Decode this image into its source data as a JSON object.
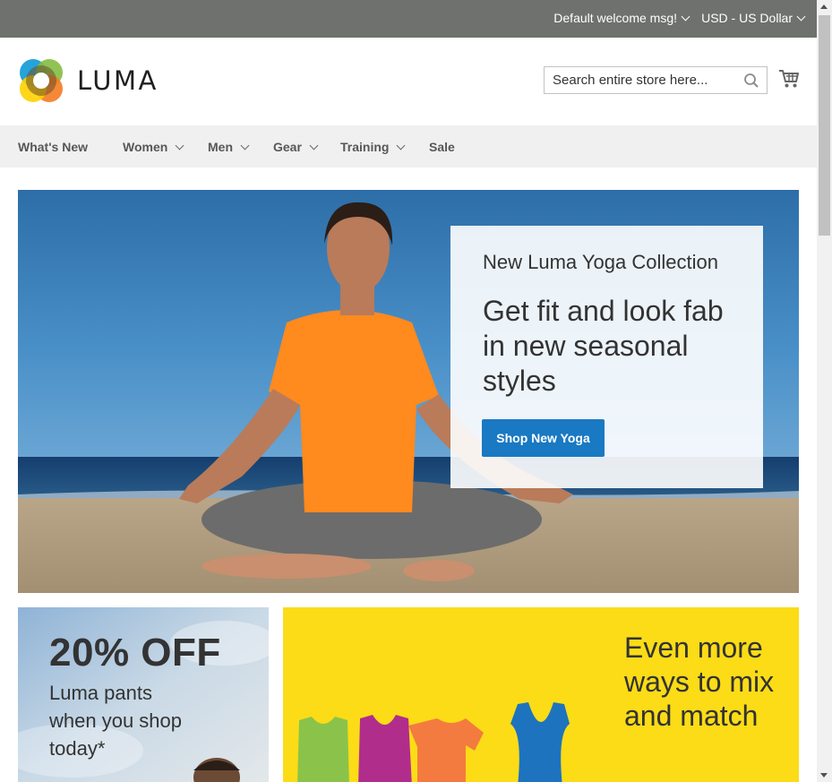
{
  "panel": {
    "welcome": "Default welcome msg!",
    "currency": "USD - US Dollar"
  },
  "header": {
    "logo_text": "LUMA",
    "search_placeholder": "Search entire store here...",
    "search_icon": "search-icon",
    "cart_icon": "cart-icon"
  },
  "nav": {
    "items": [
      {
        "label": "What's New",
        "has_dropdown": false
      },
      {
        "label": "Women",
        "has_dropdown": true
      },
      {
        "label": "Men",
        "has_dropdown": true
      },
      {
        "label": "Gear",
        "has_dropdown": true
      },
      {
        "label": "Training",
        "has_dropdown": true
      },
      {
        "label": "Sale",
        "has_dropdown": false
      }
    ]
  },
  "hero": {
    "subtitle": "New Luma Yoga Collection",
    "title": "Get fit and look fab in new seasonal styles",
    "button": "Shop New Yoga"
  },
  "promo_left": {
    "title": "20% OFF",
    "text": "Luma pants when you shop today*"
  },
  "promo_right": {
    "text": "Even more ways to mix and match"
  },
  "colors": {
    "panel_bg": "#6e716e",
    "nav_bg": "#f0f0f0",
    "primary_button": "#1979c3",
    "promo_yellow": "#fbdc17"
  }
}
